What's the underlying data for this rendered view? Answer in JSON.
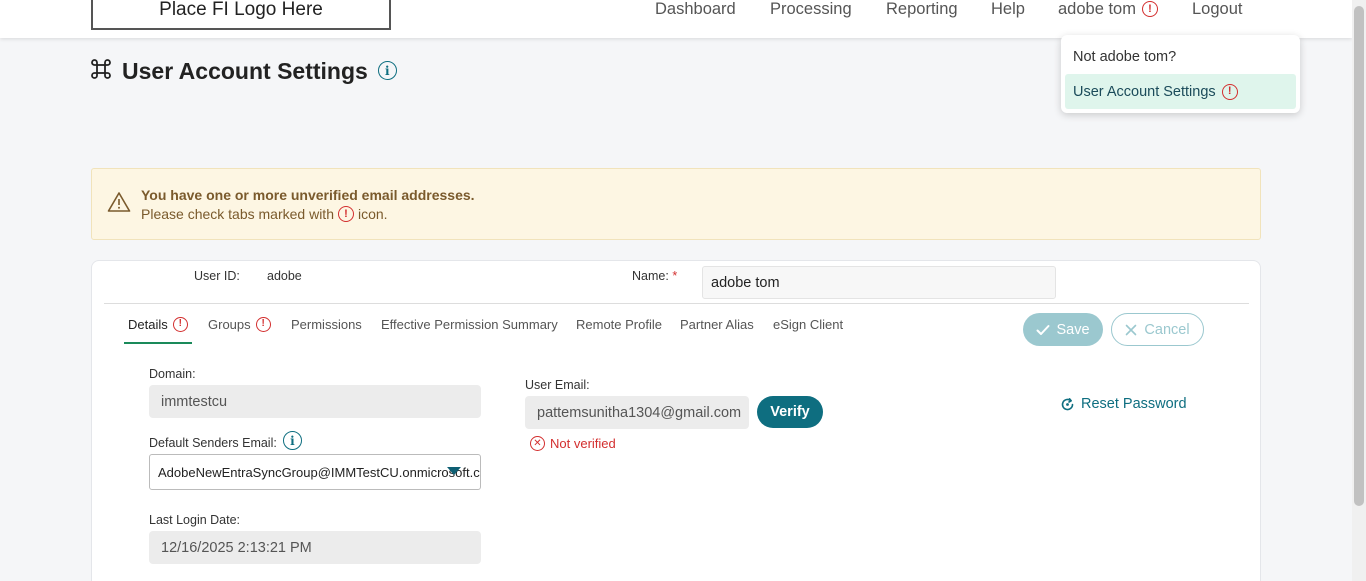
{
  "topbar": {
    "logo_text": "Place FI Logo Here",
    "nav": {
      "dashboard": "Dashboard",
      "processing": "Processing",
      "reporting": "Reporting",
      "help": "Help",
      "user": "adobe tom",
      "logout": "Logout"
    },
    "warn_glyph": "!"
  },
  "user_menu": {
    "items": [
      {
        "label": "Not adobe tom?"
      },
      {
        "label": "User Account Settings"
      }
    ]
  },
  "page": {
    "title": "User Account Settings",
    "info_glyph": "i"
  },
  "alert": {
    "line1": "You have one or more unverified email addresses.",
    "line2_before": "Please check tabs marked with",
    "line2_after": "icon."
  },
  "account": {
    "user_id_label": "User ID:",
    "user_id_value": "adobe",
    "name_label": "Name:",
    "required_mark": "*",
    "name_value": "adobe tom"
  },
  "tabs": [
    {
      "label": "Details"
    },
    {
      "label": "Groups"
    },
    {
      "label": "Permissions"
    },
    {
      "label": "Effective Permission Summary"
    },
    {
      "label": "Remote Profile"
    },
    {
      "label": "Partner Alias"
    },
    {
      "label": "eSign Client"
    }
  ],
  "actions": {
    "save": "Save",
    "cancel": "Cancel"
  },
  "details": {
    "domain_label": "Domain:",
    "domain_value": "immtestcu",
    "default_senders_label": "Default Senders Email:",
    "default_senders_value": "AdobeNewEntraSyncGroup@IMMTestCU.onmicrosoft.com",
    "last_login_label": "Last Login Date:",
    "last_login_value": "12/16/2025 2:13:21 PM",
    "user_email_label": "User Email:",
    "user_email_value": "pattemsunitha1304@gmail.com",
    "verify_label": "Verify",
    "not_verified": "Not verified",
    "x_glyph": "✕",
    "reset_password": "Reset Password"
  },
  "colors": {
    "accent": "#0e6e80",
    "warning": "#d32f2f",
    "alert_bg": "#fdf6e3",
    "active_menu_bg": "#dff5ec"
  }
}
